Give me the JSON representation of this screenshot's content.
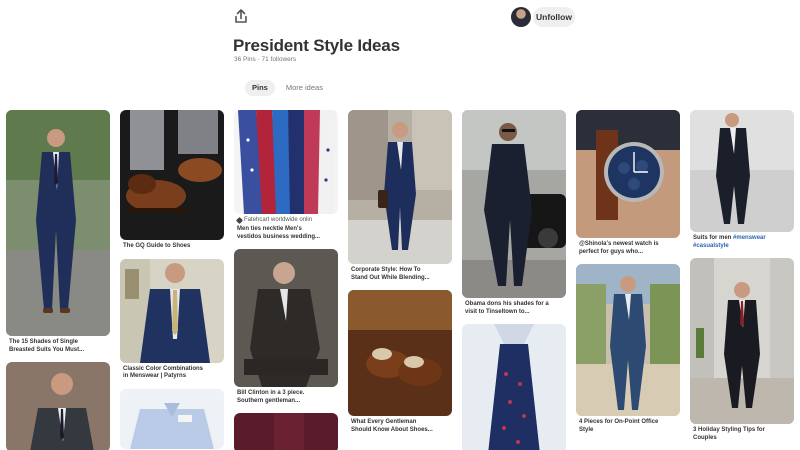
{
  "header": {
    "share_icon": "share-upload-icon",
    "unfollow_label": "Unfollow"
  },
  "board": {
    "title": "President Style Ideas",
    "pins_count": "36 Pins",
    "separator": "·",
    "followers": "71 followers"
  },
  "tabs": [
    {
      "label": "Pins",
      "active": true
    },
    {
      "label": "More ideas",
      "active": false
    }
  ],
  "pins": {
    "p1": {
      "caption": "The 15 Shades of Single\nBreasted Suits You Must..."
    },
    "p2": {
      "caption": ""
    },
    "p3": {
      "caption": "The GQ Guide to Shoes"
    },
    "p4": {
      "caption": "Classic Color Combinations\nin Menswear | Patyrns"
    },
    "p5": {
      "caption": ""
    },
    "p6": {
      "source": "Fatehcart worldwide onlin",
      "caption": "Men ties necktie Men's\nvestidos business wedding..."
    },
    "p7": {
      "caption": "Bill Clinton in a 3 piece.\nSouthern gentleman..."
    },
    "p8": {
      "caption": ""
    },
    "p9": {
      "caption": "Corporate Style: How To\nStand Out While Blending..."
    },
    "p10": {
      "caption": "What Every Gentleman\nShould Know About Shoes..."
    },
    "p11": {
      "caption": "Obama dons his shades for a\nvisit to Tinseltown to..."
    },
    "p12": {
      "caption": ""
    },
    "p13": {
      "caption": "@Shinola's newest watch is\nperfect for guys who..."
    },
    "p14": {
      "caption": "4 Pieces for On-Point Office\nStyle"
    },
    "p15": {
      "caption_prefix": "Suits for men ",
      "tag1": "#menswear",
      "tag2": "#casualstyle"
    },
    "p16": {
      "caption": "3 Holiday Styling Tips for\nCouples"
    }
  },
  "colors": {
    "accent_tab_bg": "#efefef",
    "hashtag": "#2a63b5",
    "caption_text": "#333333"
  }
}
